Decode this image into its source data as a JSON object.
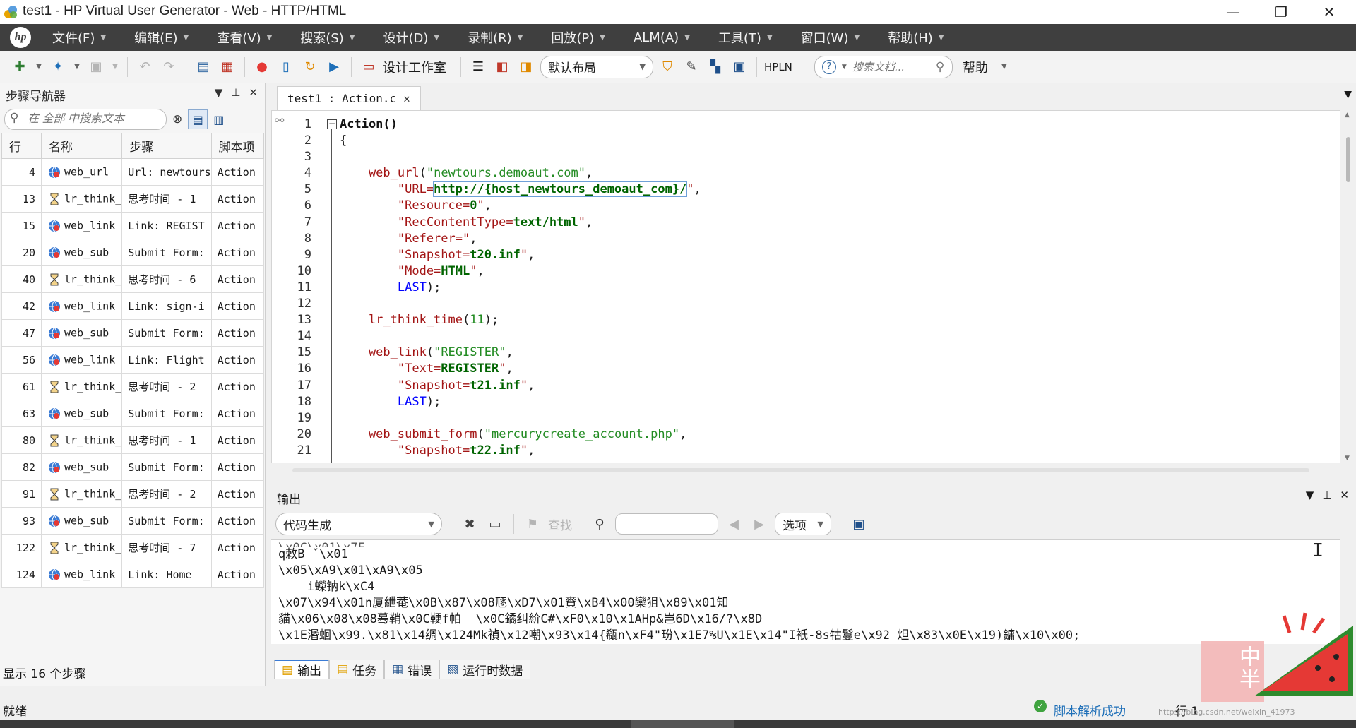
{
  "window": {
    "title": "test1 - HP Virtual User Generator - Web - HTTP/HTML",
    "minimize": "—",
    "restore": "❐",
    "close": "✕"
  },
  "menu": [
    "文件(F)",
    "编辑(E)",
    "查看(V)",
    "搜索(S)",
    "设计(D)",
    "录制(R)",
    "回放(P)",
    "ALM(A)",
    "工具(T)",
    "窗口(W)",
    "帮助(H)"
  ],
  "hp_logo": "hp",
  "toolbar": {
    "design_studio": "设计工作室",
    "layout": "默认布局",
    "hpln": "HPLN",
    "search_placeholder": "搜索文档...",
    "help": "帮助"
  },
  "navigator": {
    "title": "步骤导航器",
    "search_placeholder": "在 全部 中搜索文本",
    "columns": [
      "行",
      "名称",
      "步骤",
      "脚本项"
    ],
    "rows": [
      {
        "line": "4",
        "name": "web_url",
        "step": "Url: newtours",
        "script": "Action",
        "icon": "web"
      },
      {
        "line": "13",
        "name": "lr_think_",
        "step": "思考时间 - 1",
        "script": "Action",
        "icon": "think"
      },
      {
        "line": "15",
        "name": "web_link",
        "step": "Link: REGIST",
        "script": "Action",
        "icon": "web"
      },
      {
        "line": "20",
        "name": "web_sub",
        "step": "Submit Form:",
        "script": "Action",
        "icon": "web"
      },
      {
        "line": "40",
        "name": "lr_think_",
        "step": "思考时间 - 6",
        "script": "Action",
        "icon": "think"
      },
      {
        "line": "42",
        "name": "web_link",
        "step": "Link: sign-i",
        "script": "Action",
        "icon": "web"
      },
      {
        "line": "47",
        "name": "web_sub",
        "step": "Submit Form:",
        "script": "Action",
        "icon": "web"
      },
      {
        "line": "56",
        "name": "web_link",
        "step": "Link: Flight",
        "script": "Action",
        "icon": "web"
      },
      {
        "line": "61",
        "name": "lr_think_",
        "step": "思考时间 - 2",
        "script": "Action",
        "icon": "think"
      },
      {
        "line": "63",
        "name": "web_sub",
        "step": "Submit Form:",
        "script": "Action",
        "icon": "web"
      },
      {
        "line": "80",
        "name": "lr_think_",
        "step": "思考时间 - 1",
        "script": "Action",
        "icon": "think"
      },
      {
        "line": "82",
        "name": "web_sub",
        "step": "Submit Form:",
        "script": "Action",
        "icon": "web"
      },
      {
        "line": "91",
        "name": "lr_think_",
        "step": "思考时间 - 2",
        "script": "Action",
        "icon": "think"
      },
      {
        "line": "93",
        "name": "web_sub",
        "step": "Submit Form:",
        "script": "Action",
        "icon": "web"
      },
      {
        "line": "122",
        "name": "lr_think_",
        "step": "思考时间 - 7",
        "script": "Action",
        "icon": "think"
      },
      {
        "line": "124",
        "name": "web_link",
        "step": "Link: Home",
        "script": "Action",
        "icon": "web"
      }
    ],
    "footer": "显示 16 个步骤"
  },
  "editor": {
    "tab_label": "test1 : Action.c",
    "line_numbers": [
      "1",
      "2",
      "3",
      "4",
      "5",
      "6",
      "7",
      "8",
      "9",
      "10",
      "11",
      "12",
      "13",
      "14",
      "15",
      "16",
      "17",
      "18",
      "19",
      "20",
      "21"
    ],
    "lines": [
      [
        {
          "t": "Action()",
          "c": "blk"
        }
      ],
      [
        {
          "t": "{",
          "c": ""
        }
      ],
      [
        {
          "t": "",
          "c": ""
        }
      ],
      [
        {
          "t": "    web_url",
          "c": "fn"
        },
        {
          "t": "(",
          "c": ""
        },
        {
          "t": "\"newtours.demoaut.com\"",
          "c": "str"
        },
        {
          "t": ",",
          "c": ""
        }
      ],
      [
        {
          "t": "        \"URL=",
          "c": "fn"
        },
        {
          "t": "http://{host_newtours_demoaut_com}/",
          "c": "param"
        },
        {
          "t": "\"",
          "c": "fn"
        },
        {
          "t": ",",
          "c": ""
        }
      ],
      [
        {
          "t": "        \"Resource=",
          "c": "fn"
        },
        {
          "t": "0",
          "c": "param"
        },
        {
          "t": "\"",
          "c": "fn"
        },
        {
          "t": ",",
          "c": ""
        }
      ],
      [
        {
          "t": "        \"RecContentType=",
          "c": "fn"
        },
        {
          "t": "text/html",
          "c": "param"
        },
        {
          "t": "\"",
          "c": "fn"
        },
        {
          "t": ",",
          "c": ""
        }
      ],
      [
        {
          "t": "        \"Referer=",
          "c": "fn"
        },
        {
          "t": "\"",
          "c": "fn"
        },
        {
          "t": ",",
          "c": ""
        }
      ],
      [
        {
          "t": "        \"Snapshot=",
          "c": "fn"
        },
        {
          "t": "t20.inf",
          "c": "param"
        },
        {
          "t": "\"",
          "c": "fn"
        },
        {
          "t": ",",
          "c": ""
        }
      ],
      [
        {
          "t": "        \"Mode=",
          "c": "fn"
        },
        {
          "t": "HTML",
          "c": "param"
        },
        {
          "t": "\"",
          "c": "fn"
        },
        {
          "t": ",",
          "c": ""
        }
      ],
      [
        {
          "t": "        LAST",
          "c": "kw"
        },
        {
          "t": ");",
          "c": ""
        }
      ],
      [
        {
          "t": "",
          "c": ""
        }
      ],
      [
        {
          "t": "    lr_think_time",
          "c": "fn"
        },
        {
          "t": "(",
          "c": ""
        },
        {
          "t": "11",
          "c": "str"
        },
        {
          "t": ");",
          "c": ""
        }
      ],
      [
        {
          "t": "",
          "c": ""
        }
      ],
      [
        {
          "t": "    web_link",
          "c": "fn"
        },
        {
          "t": "(",
          "c": ""
        },
        {
          "t": "\"REGISTER\"",
          "c": "str"
        },
        {
          "t": ",",
          "c": ""
        }
      ],
      [
        {
          "t": "        \"Text=",
          "c": "fn"
        },
        {
          "t": "REGISTER",
          "c": "param"
        },
        {
          "t": "\"",
          "c": "fn"
        },
        {
          "t": ",",
          "c": ""
        }
      ],
      [
        {
          "t": "        \"Snapshot=",
          "c": "fn"
        },
        {
          "t": "t21.inf",
          "c": "param"
        },
        {
          "t": "\"",
          "c": "fn"
        },
        {
          "t": ",",
          "c": ""
        }
      ],
      [
        {
          "t": "        LAST",
          "c": "kw"
        },
        {
          "t": ");",
          "c": ""
        }
      ],
      [
        {
          "t": "",
          "c": ""
        }
      ],
      [
        {
          "t": "    web_submit_form",
          "c": "fn"
        },
        {
          "t": "(",
          "c": ""
        },
        {
          "t": "\"mercurycreate_account.php\"",
          "c": "str"
        },
        {
          "t": ",",
          "c": ""
        }
      ],
      [
        {
          "t": "        \"Snapshot=",
          "c": "fn"
        },
        {
          "t": "t22.inf",
          "c": "param"
        },
        {
          "t": "\"",
          "c": "fn"
        },
        {
          "t": ",",
          "c": ""
        }
      ]
    ]
  },
  "output": {
    "title": "输出",
    "dropdown": "代码生成",
    "find": "查找",
    "options": "选项",
    "lines": [
      "q敕B ˇ\\x01",
      "\\x05\\xA9\\x01\\xA9\\x05",
      "    i蠑钠k\\xC4",
      "\\x07\\x94\\x01n厦紲菴\\x0B\\x87\\x08豗\\xD7\\x01賚\\xB4\\x00欒狙\\x89\\x01知",
      "貓\\x06\\x08\\x08蓦鞘\\x0C鞕f帕  \\x0C鐍纠紒C#\\xF0\\x10\\x1AHp&岂6D\\x16/?\\x8D",
      "\\x1E湣蛔\\x99.\\x81\\x14绸\\x124Mk禎\\x12嘲\\x93\\x14{瓻n\\xF4\"玢\\x1E7%U\\x1E\\x14\"I衹-8s牯鬘e\\x92 炟\\x83\\x0E\\x19)鏞\\x10\\x00;"
    ],
    "tabs": [
      "输出",
      "任务",
      "错误",
      "运行时数据"
    ]
  },
  "status": {
    "left": "就绪",
    "parse": "脚本解析成功",
    "line": "行 1"
  },
  "watermark": {
    "chars": "中半",
    "url": "https://blog.csdn.net/weixin_41973"
  }
}
